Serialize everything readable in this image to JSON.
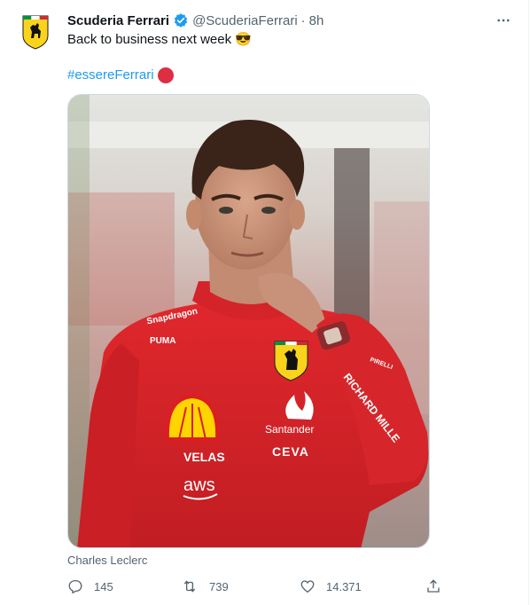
{
  "tweet": {
    "display_name": "Scuderia Ferrari",
    "handle": "@ScuderiaFerrari",
    "separator": "·",
    "time": "8h",
    "text": "Back to business next week 😎",
    "hashtag": "#essereFerrari",
    "media_caption": "Charles Leclerc",
    "media_text": {
      "sponsor_top": "Snapdragon",
      "sponsor_brand": "PUMA",
      "sponsor_santander": "Santander",
      "sponsor_velas": "VELAS",
      "sponsor_ceva": "CEVA",
      "sponsor_aws": "aws",
      "sleeve": "RICHARD MILLE",
      "pirelli": "PIRELLI"
    },
    "stats": {
      "replies": "145",
      "retweets": "739",
      "likes": "14.371"
    }
  },
  "colors": {
    "accent": "#1d9bf0",
    "text": "#0f1419",
    "muted": "#536471",
    "ferrari_red": "#dd2e44",
    "ferrari_yellow": "#f9d41b"
  },
  "icons": [
    "ferrari-logo",
    "verified-icon",
    "more-icon",
    "reply-icon",
    "retweet-icon",
    "like-icon",
    "share-icon"
  ]
}
